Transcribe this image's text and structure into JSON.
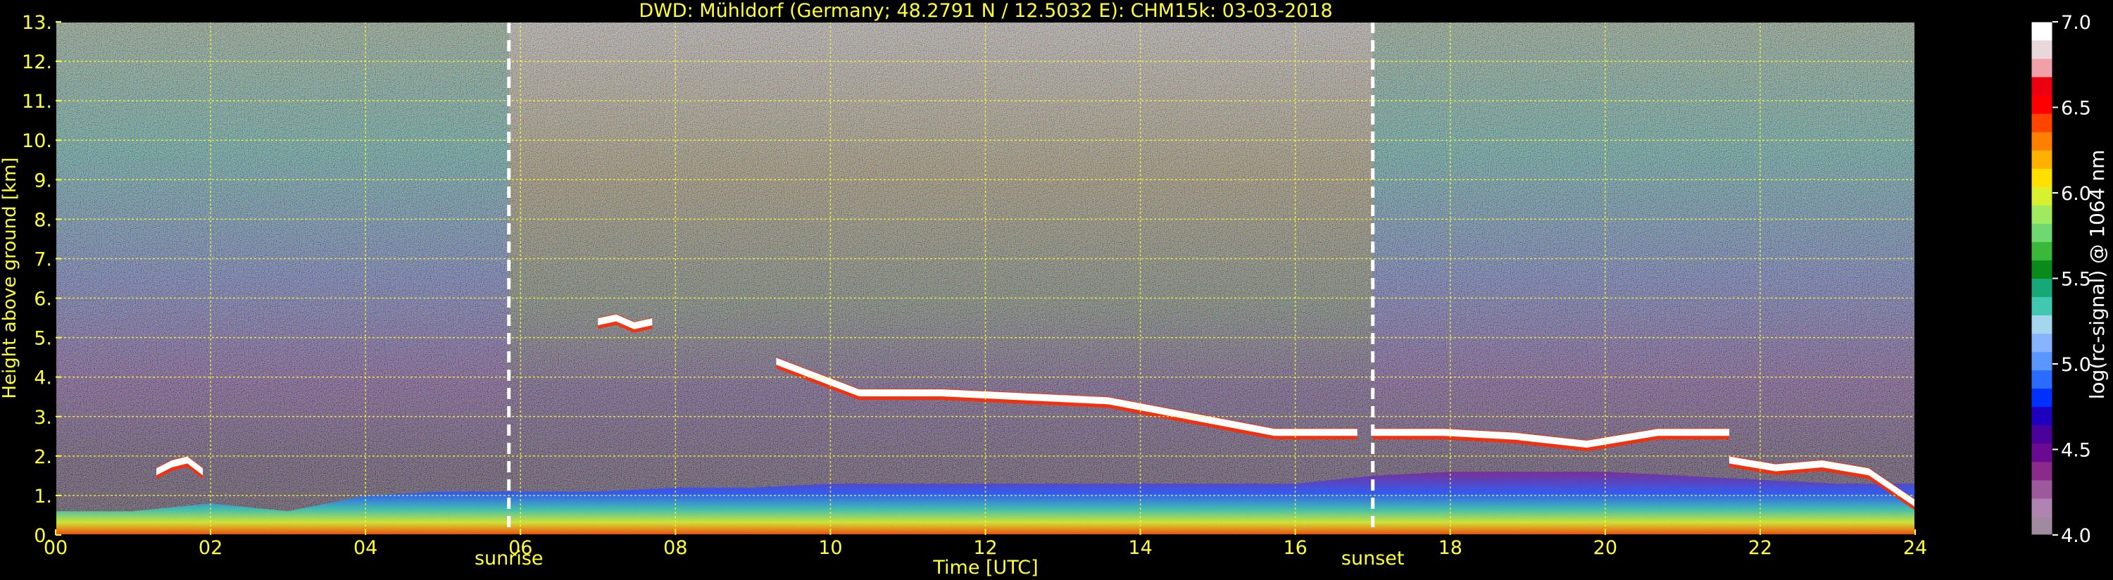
{
  "chart_data": {
    "type": "heatmap",
    "title": "DWD: Mühldorf (Germany; 48.2791 N / 12.5032 E):    CHM15k: 03-03-2018",
    "xlabel": "Time [UTC]",
    "ylabel": "Height above ground [km]",
    "xlim": [
      0,
      24
    ],
    "ylim": [
      0,
      13
    ],
    "x_ticks": [
      0,
      2,
      4,
      6,
      8,
      10,
      12,
      14,
      16,
      18,
      20,
      22,
      24
    ],
    "x_tick_labels": [
      "00",
      "02",
      "04",
      "06",
      "08",
      "10",
      "12",
      "14",
      "16",
      "18",
      "20",
      "22",
      "24"
    ],
    "y_ticks": [
      0,
      1,
      2,
      3,
      4,
      5,
      6,
      7,
      8,
      9,
      10,
      11,
      12,
      13
    ],
    "y_tick_labels": [
      "0.",
      "1.",
      "2.",
      "3.",
      "4.",
      "5.",
      "6.",
      "7.",
      "8.",
      "9.",
      "10.",
      "11.",
      "12.",
      "13."
    ],
    "grid": true,
    "colorbar": {
      "label": "log(rc-signal) @ 1064 nm",
      "range": [
        4.0,
        7.0
      ],
      "ticks": [
        4.0,
        4.5,
        5.0,
        5.5,
        6.0,
        6.5,
        7.0
      ],
      "tick_labels": [
        "4.0",
        "4.5",
        "5.0",
        "5.5",
        "6.0",
        "6.5",
        "7.0"
      ],
      "colors": [
        "#a08aa0",
        "#b084b0",
        "#9c5a9c",
        "#8a2a8a",
        "#6a0a90",
        "#4a009a",
        "#2000c0",
        "#0030ff",
        "#2a6cff",
        "#5a96ff",
        "#88b4ff",
        "#a6d6ee",
        "#40c8b0",
        "#18a878",
        "#0a8a1a",
        "#3ab83a",
        "#70d870",
        "#a0ea60",
        "#d8f030",
        "#ffe000",
        "#ffb000",
        "#ff8000",
        "#ff4400",
        "#ff0000",
        "#ec0010",
        "#f0a0a8",
        "#e8d8dc",
        "#ffffff"
      ]
    },
    "markers": [
      {
        "label": "sunrise",
        "x": 5.85
      },
      {
        "label": "sunset",
        "x": 17.0
      }
    ],
    "cloud_layers": [
      {
        "x_start": 9.3,
        "x_end": 16.8,
        "y": [
          4.4,
          3.6,
          3.6,
          3.5,
          3.4,
          3.0,
          2.6,
          2.6
        ]
      },
      {
        "x_start": 7.0,
        "x_end": 7.7,
        "y": [
          5.4,
          5.5,
          5.3,
          5.4
        ]
      },
      {
        "x_start": 17.0,
        "x_end": 21.6,
        "y": [
          2.6,
          2.6,
          2.5,
          2.3,
          2.6,
          2.6
        ]
      },
      {
        "x_start": 21.6,
        "x_end": 24.0,
        "y": [
          1.9,
          1.7,
          1.8,
          1.6,
          0.8
        ]
      },
      {
        "x_start": 1.3,
        "x_end": 1.9,
        "y": [
          1.6,
          1.8,
          1.9,
          1.6
        ]
      }
    ],
    "boundary_layer": {
      "x": [
        0,
        1,
        2,
        3,
        4,
        5,
        6,
        7,
        8,
        9,
        10,
        11,
        12,
        13,
        14,
        15,
        16,
        17,
        18,
        19,
        20,
        21,
        22,
        23,
        24
      ],
      "top_km": [
        0.6,
        0.6,
        0.8,
        0.6,
        1.0,
        1.1,
        1.1,
        1.1,
        1.2,
        1.2,
        1.3,
        1.3,
        1.3,
        1.3,
        1.3,
        1.3,
        1.3,
        1.5,
        1.6,
        1.6,
        1.6,
        1.5,
        1.4,
        1.3,
        1.3
      ]
    }
  }
}
